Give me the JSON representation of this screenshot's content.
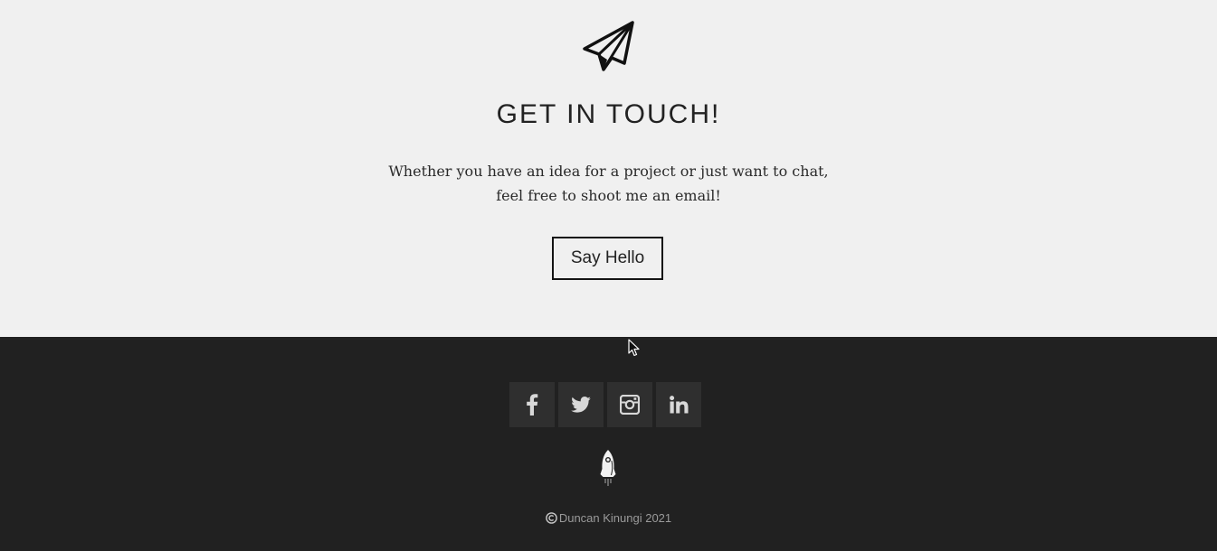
{
  "contact": {
    "title": "GET IN TOUCH!",
    "text_line1": "Whether you have an idea for a project or just want to chat,",
    "text_line2": "feel free to shoot me an email!",
    "button_label": "Say Hello",
    "icon": "paper-plane-icon"
  },
  "footer": {
    "socials": [
      {
        "name": "Facebook",
        "icon": "facebook-icon"
      },
      {
        "name": "Twitter",
        "icon": "twitter-icon"
      },
      {
        "name": "Instagram",
        "icon": "instagram-icon"
      },
      {
        "name": "LinkedIn",
        "icon": "linkedin-icon"
      }
    ],
    "logo_icon": "rocket-icon",
    "copyright": "Duncan Kinungi 2021"
  },
  "colors": {
    "contact_bg": "#f0f0f0",
    "footer_bg": "#212121",
    "social_bg": "#2f2f2f",
    "text_dark": "#222222",
    "footer_text": "#9a9a9a"
  }
}
